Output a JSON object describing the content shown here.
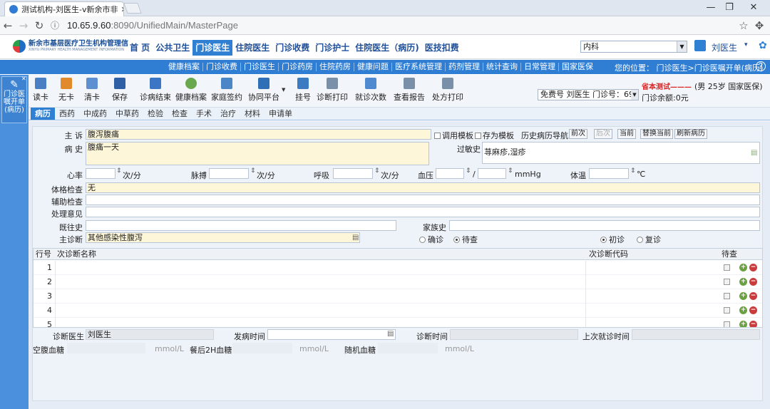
{
  "browser": {
    "tab_title": "测试机构-刘医生-v新余市非",
    "url_host": "10.65.9.60",
    "url_rest": ":8090/UnifiedMain/MasterPage"
  },
  "app": {
    "logo_name": "新余市基层医疗卫生机构管理信",
    "logo_sub": "XINYU PRIMARY HEALTH MANAGEMENT INFORMATION",
    "menu": [
      "首 页",
      "公共卫生",
      "门诊医生",
      "住院医生",
      "门诊收费",
      "门诊护士",
      "住院医生（病历)",
      "医技扣费"
    ],
    "active_menu": "门诊医生",
    "department": "内科",
    "user": "刘医生"
  },
  "subnav": [
    "健康档案",
    "门诊收费",
    "门诊医生",
    "门诊药房",
    "住院药房",
    "健康问题",
    "医疗系统管理",
    "药剂管理",
    "统计查询",
    "日常管理",
    "国家医保"
  ],
  "location": "您的位置： 门诊医生>门诊医嘱开单(病历)",
  "left_card": {
    "title": "门诊医嘱开单(病历)"
  },
  "toolbar": {
    "buttons": [
      "读卡",
      "无卡",
      "清卡",
      "保存",
      "诊病结束",
      "健康档案",
      "家庭签约",
      "协同平台",
      "挂号",
      "诊断打印",
      "就诊次数",
      "查看报告",
      "处方打印"
    ],
    "patient_select": "免费号 刘医生  门诊号：69",
    "patient_info_name": "省本测试———",
    "patient_info_detail": "(男 25岁 国家医保)",
    "balance": "门诊余额:0元"
  },
  "tabs": [
    "病历",
    "西药",
    "中成药",
    "中草药",
    "检验",
    "检查",
    "手术",
    "治疗",
    "材料",
    "申请单"
  ],
  "active_tab": "病历",
  "form": {
    "chief_label": "主 诉",
    "chief_value": "腹泻腹痛",
    "template_use": "调用模板",
    "template_save": "存为模板",
    "history_nav": "历史病历导航",
    "nav_buttons": [
      "前次",
      "后次",
      "当前",
      "替换当前",
      "刷新病历"
    ],
    "history_label": "病 史",
    "history_value": "腹痛一天",
    "allergy_label": "过敏史",
    "allergy_value": "荨麻疹,湿疹",
    "vitals": [
      {
        "label": "心率",
        "unit": "次/分"
      },
      {
        "label": "脉搏",
        "unit": "次/分"
      },
      {
        "label": "呼吸",
        "unit": "次/分"
      },
      {
        "label": "血压",
        "unit": "mmHg"
      },
      {
        "label": "体温",
        "unit": "℃"
      }
    ],
    "exam_label": "体格检查",
    "exam_value": "无",
    "aux_label": "辅助检查",
    "opinion_label": "处理意见",
    "past_label": "既往史",
    "family_label": "家族史",
    "main_diag_label": "主诊断",
    "main_diag_value": "其他感染性腹泻",
    "confirm": "确诊",
    "pending": "待查",
    "first_visit": "初诊",
    "return_visit": "复诊"
  },
  "table": {
    "headers": [
      "行号",
      "次诊断名称",
      "次诊断代码",
      "待查"
    ],
    "rows": [
      "1",
      "2",
      "3",
      "4",
      "5"
    ]
  },
  "footer": {
    "doctor_label": "诊断医生",
    "doctor_value": "刘医生",
    "onset_label": "发病时间",
    "diag_time_label": "诊断时间",
    "last_visit_label": "上次就诊时间",
    "fasting_label": "空腹血糖",
    "post_label": "餐后2H血糖",
    "random_label": "随机血糖",
    "unit": "mmol/L"
  }
}
